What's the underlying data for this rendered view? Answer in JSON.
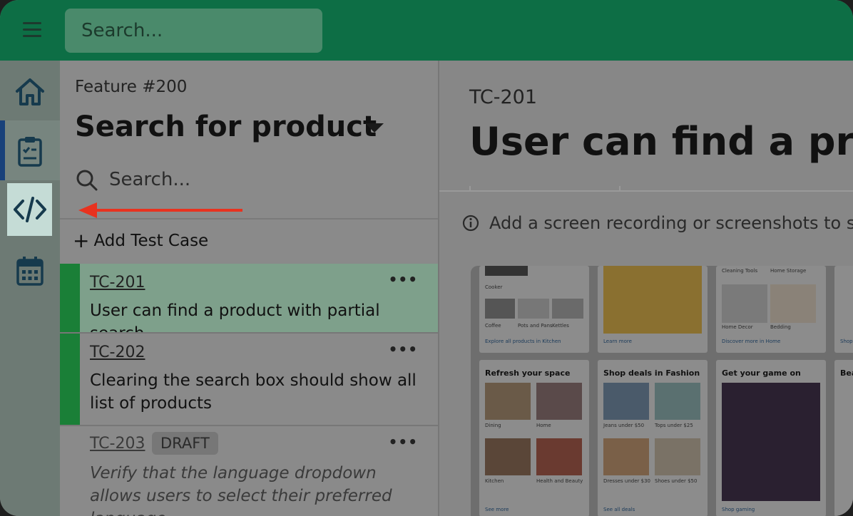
{
  "topbar": {
    "search_placeholder": "Search..."
  },
  "rail": {
    "icons": [
      "home-icon",
      "clipboard-checklist-icon",
      "code-icon",
      "calendar-icon"
    ]
  },
  "feature": {
    "id": "Feature #200",
    "title": "Search for product"
  },
  "list_search": {
    "placeholder": "Search..."
  },
  "add_test_case": "Add Test Case",
  "test_cases": [
    {
      "id": "TC-201",
      "title": "User can find a product with partial search",
      "menu": "•••"
    },
    {
      "id": "TC-202",
      "title": "Clearing the search box should show all list of products",
      "menu": "•••"
    },
    {
      "id": "TC-203",
      "badge": "DRAFT",
      "title": "Verify that the language dropdown allows users to select their preferred language.",
      "menu": "•••"
    }
  ],
  "detail": {
    "id": "TC-201",
    "title": "User can find a pro",
    "hint": "Add a screen recording or screenshots to sho"
  },
  "screenshot": {
    "top_row": {
      "card1": {
        "top_caption": "Cooker",
        "items": [
          "Coffee",
          "Pots and Pans",
          "Kettles"
        ],
        "link": "Explore all products in Kitchen"
      },
      "card2": {
        "link": "Learn more"
      },
      "card3": {
        "top_captions": [
          "Cleaning Tools",
          "Home Storage"
        ],
        "items": [
          "Home Decor",
          "Bedding"
        ],
        "link": "Discover more in Home"
      },
      "card4": {
        "link": "Shop"
      }
    },
    "bottom_row": {
      "card1": {
        "title": "Refresh your space",
        "items": [
          "Dining",
          "Home",
          "Kitchen",
          "Health and Beauty"
        ],
        "link": "See more"
      },
      "card2": {
        "title": "Shop deals in Fashion",
        "items": [
          "Jeans under $50",
          "Tops under $25",
          "Dresses under $30",
          "Shoes under $50"
        ],
        "link": "See all deals"
      },
      "card3": {
        "title": "Get your game on",
        "link": "Shop gaming"
      },
      "card4": {
        "title": "Bea"
      }
    }
  },
  "colors": {
    "topbar": "#0d6e45",
    "active_bar": "#1a7f37",
    "arrow": "#e8321f",
    "rail_highlight": "#c5dcd6"
  }
}
